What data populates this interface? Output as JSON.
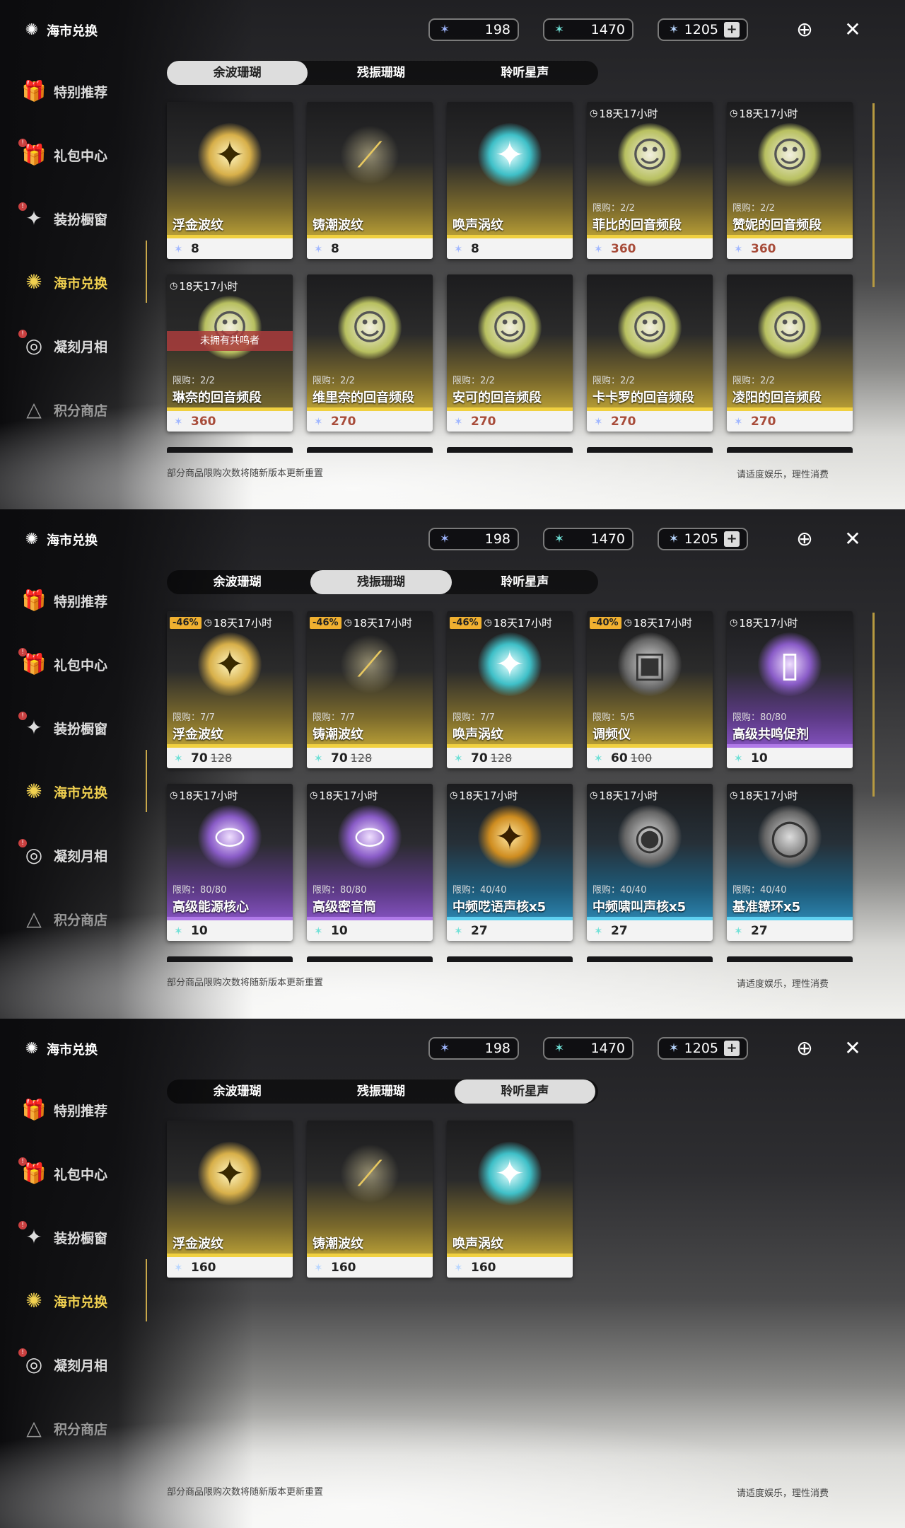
{
  "header": {
    "section_title": "海市兑换",
    "currencies": [
      {
        "value": "198",
        "icon": "afterglow-coral-icon"
      },
      {
        "value": "1470",
        "icon": "oscillate-coral-icon"
      },
      {
        "value": "1205",
        "icon": "lustrous-tide-icon",
        "has_plus": true
      }
    ],
    "plus": "+"
  },
  "sidebar": {
    "items": [
      {
        "label": "特别推荐"
      },
      {
        "label": "礼包中心"
      },
      {
        "label": "装扮橱窗"
      },
      {
        "label": "海市兑换"
      },
      {
        "label": "凝刻月相"
      },
      {
        "label": "积分商店"
      }
    ]
  },
  "tabs": [
    "余波珊瑚",
    "残振珊瑚",
    "聆听星声"
  ],
  "footer": {
    "note": "部分商品限购次数将随新版本更新重置",
    "advice": "请适度娱乐，理性消费"
  },
  "screens": [
    {
      "selected_tab": 0,
      "items": [
        {
          "name": "浮金波纹",
          "price": "8"
        },
        {
          "name": "铸潮波纹",
          "price": "8"
        },
        {
          "name": "唤声涡纹",
          "price": "8"
        },
        {
          "name": "菲比的回音频段",
          "price": "360",
          "timer": "18天17小时",
          "limit": "限购：2/2"
        },
        {
          "name": "赞妮的回音频段",
          "price": "360",
          "timer": "18天17小时",
          "limit": "限购：2/2"
        },
        {
          "name": "琳奈的回音频段",
          "price": "360",
          "timer": "18天17小时",
          "limit": "限购：2/2",
          "banner": "未拥有共鸣者"
        },
        {
          "name": "维里奈的回音频段",
          "price": "270",
          "limit": "限购：2/2"
        },
        {
          "name": "安可的回音频段",
          "price": "270",
          "limit": "限购：2/2"
        },
        {
          "name": "卡卡罗的回音频段",
          "price": "270",
          "limit": "限购：2/2"
        },
        {
          "name": "凌阳的回音频段",
          "price": "270",
          "limit": "限购：2/2"
        }
      ]
    },
    {
      "selected_tab": 1,
      "items": [
        {
          "name": "浮金波纹",
          "price": "70",
          "old_price": "128",
          "discount": "-46%",
          "timer": "18天17小时",
          "limit": "限购：7/7"
        },
        {
          "name": "铸潮波纹",
          "price": "70",
          "old_price": "128",
          "discount": "-46%",
          "timer": "18天17小时",
          "limit": "限购：7/7"
        },
        {
          "name": "唤声涡纹",
          "price": "70",
          "old_price": "128",
          "discount": "-46%",
          "timer": "18天17小时",
          "limit": "限购：7/7"
        },
        {
          "name": "调频仪",
          "price": "60",
          "old_price": "100",
          "discount": "-40%",
          "timer": "18天17小时",
          "limit": "限购：5/5"
        },
        {
          "name": "高级共鸣促剂",
          "price": "10",
          "timer": "18天17小时",
          "limit": "限购：80/80"
        },
        {
          "name": "高级能源核心",
          "price": "10",
          "timer": "18天17小时",
          "limit": "限购：80/80"
        },
        {
          "name": "高级密音筒",
          "price": "10",
          "timer": "18天17小时",
          "limit": "限购：80/80"
        },
        {
          "name": "中频呓语声核x5",
          "price": "27",
          "timer": "18天17小时",
          "limit": "限购：40/40"
        },
        {
          "name": "中频啸叫声核x5",
          "price": "27",
          "timer": "18天17小时",
          "limit": "限购：40/40"
        },
        {
          "name": "基准镣环x5",
          "price": "27",
          "timer": "18天17小时",
          "limit": "限购：40/40"
        }
      ]
    },
    {
      "selected_tab": 2,
      "items": [
        {
          "name": "浮金波纹",
          "price": "160"
        },
        {
          "name": "铸潮波纹",
          "price": "160"
        },
        {
          "name": "唤声涡纹",
          "price": "160"
        }
      ]
    }
  ]
}
